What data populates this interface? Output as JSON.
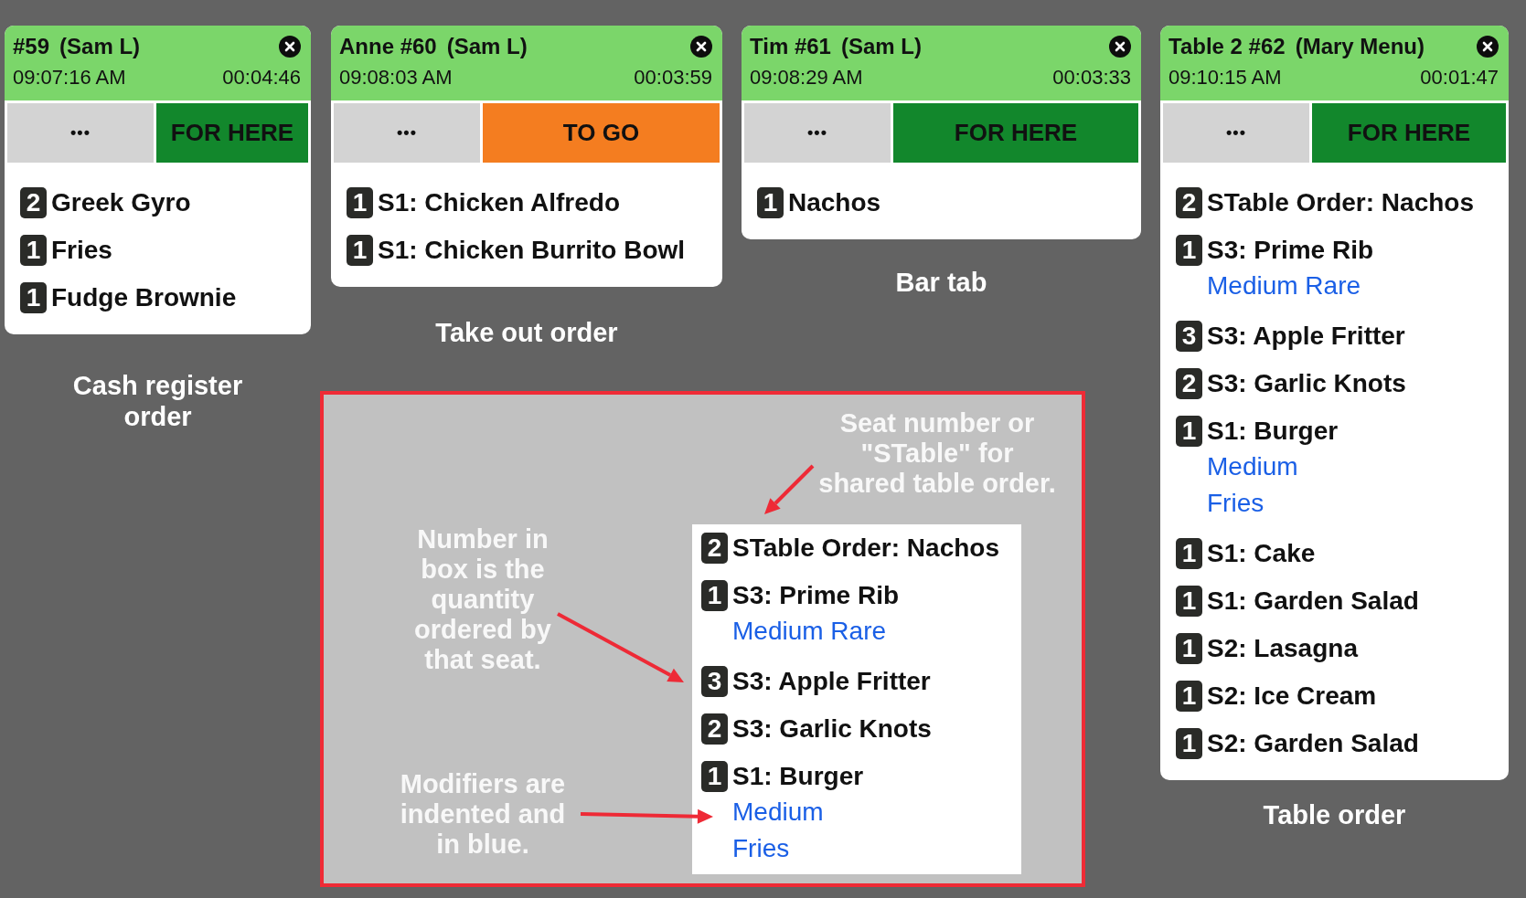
{
  "orders": [
    {
      "title": "#59",
      "server": "(Sam L)",
      "time": "09:07:16 AM",
      "elapsed": "00:04:46",
      "menu_button": "•••",
      "service": {
        "label": "FOR HERE",
        "kind": "dine_in"
      },
      "items": [
        {
          "qty": "2",
          "name": "Greek Gyro"
        },
        {
          "qty": "1",
          "name": "Fries"
        },
        {
          "qty": "1",
          "name": "Fudge Brownie"
        }
      ],
      "caption": "Cash register order"
    },
    {
      "title": "Anne #60",
      "server": "(Sam L)",
      "time": "09:08:03 AM",
      "elapsed": "00:03:59",
      "menu_button": "•••",
      "service": {
        "label": "TO GO",
        "kind": "to_go"
      },
      "items": [
        {
          "qty": "1",
          "name": "S1: Chicken Alfredo"
        },
        {
          "qty": "1",
          "name": "S1: Chicken Burrito Bowl"
        }
      ],
      "caption": "Take out order"
    },
    {
      "title": "Tim #61",
      "server": "(Sam L)",
      "time": "09:08:29 AM",
      "elapsed": "00:03:33",
      "menu_button": "•••",
      "service": {
        "label": "FOR HERE",
        "kind": "dine_in"
      },
      "items": [
        {
          "qty": "1",
          "name": "Nachos"
        }
      ],
      "caption": "Bar tab"
    },
    {
      "title": "Table 2 #62",
      "server": "(Mary Menu)",
      "time": "09:10:15 AM",
      "elapsed": "00:01:47",
      "menu_button": "•••",
      "service": {
        "label": "FOR HERE",
        "kind": "dine_in"
      },
      "items": [
        {
          "qty": "2",
          "name": "STable Order: Nachos"
        },
        {
          "qty": "1",
          "name": "S3: Prime Rib",
          "modifiers": [
            "Medium Rare"
          ]
        },
        {
          "qty": "3",
          "name": "S3: Apple Fritter"
        },
        {
          "qty": "2",
          "name": "S3: Garlic Knots"
        },
        {
          "qty": "1",
          "name": "S1: Burger",
          "modifiers": [
            "Medium",
            "Fries"
          ]
        },
        {
          "qty": "1",
          "name": "S1: Cake"
        },
        {
          "qty": "1",
          "name": "S1: Garden Salad"
        },
        {
          "qty": "1",
          "name": "S2: Lasagna"
        },
        {
          "qty": "1",
          "name": "S2: Ice Cream"
        },
        {
          "qty": "1",
          "name": "S2: Garden Salad"
        }
      ],
      "caption": "Table order"
    }
  ],
  "callout": {
    "seat_note": "Seat number or\n\"STable\" for\nshared table order.",
    "quantity_note": "Number in\nbox is the\nquantity\nordered by\nthat seat.",
    "modifier_note": "Modifiers are\nindented and\nin blue.",
    "example_items": [
      {
        "qty": "2",
        "name": "STable Order: Nachos"
      },
      {
        "qty": "1",
        "name": "S3: Prime Rib",
        "modifiers": [
          "Medium Rare"
        ]
      },
      {
        "qty": "3",
        "name": "S3: Apple Fritter"
      },
      {
        "qty": "2",
        "name": "S3: Garlic Knots"
      },
      {
        "qty": "1",
        "name": "S1: Burger",
        "modifiers": [
          "Medium",
          "Fries"
        ]
      }
    ]
  }
}
